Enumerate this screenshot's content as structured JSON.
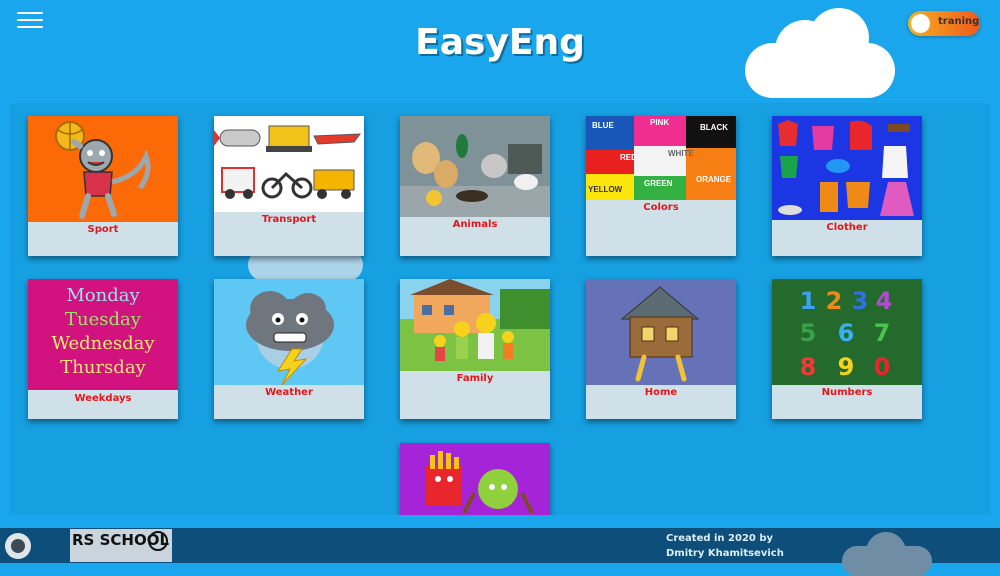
{
  "header": {
    "title": "EasyEng",
    "mode_toggle_label": "traning"
  },
  "categories": [
    {
      "label": "Sport"
    },
    {
      "label": "Transport"
    },
    {
      "label": "Animals"
    },
    {
      "label": "Colors"
    },
    {
      "label": "Clother"
    },
    {
      "label": "Weekdays"
    },
    {
      "label": "Weather"
    },
    {
      "label": "Family"
    },
    {
      "label": "Home"
    },
    {
      "label": "Numbers"
    },
    {
      "label": ""
    }
  ],
  "colors_card": {
    "words": [
      "BLUE",
      "PINK",
      "BLACK",
      "RED",
      "WHITE",
      "GREEN",
      "ORANGE",
      "YELLOW"
    ]
  },
  "weekdays_card": {
    "days": [
      "Monday",
      "Tuesday",
      "Wednesday",
      "Thursday"
    ]
  },
  "numbers_card": {
    "digits": [
      "1",
      "2",
      "3",
      "4",
      "5",
      "6",
      "7",
      "8",
      "9",
      "0"
    ]
  },
  "footer": {
    "school_logo": "RS SCHOOL JS",
    "credit_line1": "Created in 2020 by",
    "credit_line2": "Dmitry Khamitsevich"
  },
  "colors": {
    "background": "#1aa6ec",
    "card_caption_bg": "#cfe0e8",
    "label_red": "#e4161b",
    "footer_bg": "#0d4f7a"
  }
}
